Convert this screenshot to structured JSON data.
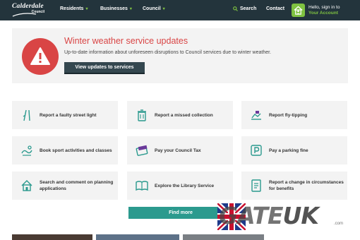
{
  "header": {
    "logo_main": "Calderdale",
    "logo_sub": "Council",
    "nav": [
      {
        "label": "Residents"
      },
      {
        "label": "Businesses"
      },
      {
        "label": "Council"
      }
    ],
    "search_label": "Search",
    "contact_label": "Contact",
    "account_line1": "Hello, sign in to",
    "account_line2": "Your Account"
  },
  "alert": {
    "title": "Winter weather service updates",
    "description": "Up-to-date information about unforeseen disruptions to Council services due to winter weather.",
    "button_label": "View updates to services"
  },
  "tiles": [
    {
      "label": "Report a faulty street light",
      "icon": "street-light-icon"
    },
    {
      "label": "Report a missed collection",
      "icon": "bin-icon"
    },
    {
      "label": "Report fly-tipping",
      "icon": "fly-tipping-icon"
    },
    {
      "label": "Book sport activities and classes",
      "icon": "sport-icon"
    },
    {
      "label": "Pay your Council Tax",
      "icon": "wallet-icon"
    },
    {
      "label": "Pay a parking fine",
      "icon": "parking-icon"
    },
    {
      "label": "Search and comment on planning applications",
      "icon": "house-icon"
    },
    {
      "label": "Explore the Library Service",
      "icon": "book-icon"
    },
    {
      "label": "Report a change in circumstances for benefits",
      "icon": "document-icon"
    }
  ],
  "find_more_label": "Find more",
  "watermark": {
    "text_a": "GATE",
    "text_b": "UK",
    "suffix": ".com"
  },
  "colors": {
    "header_bg": "#23343c",
    "accent_green": "#7fc241",
    "alert_red": "#d94545",
    "teal": "#2b9a8e"
  }
}
